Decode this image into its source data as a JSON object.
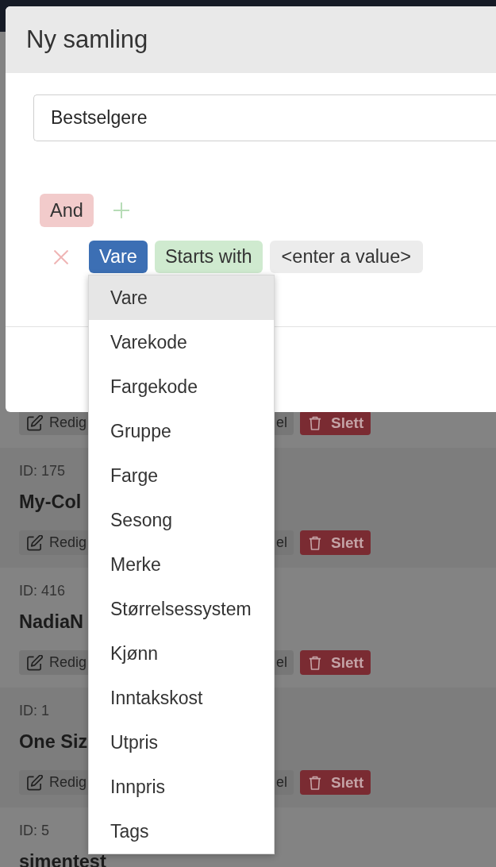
{
  "modal": {
    "title": "Ny samling",
    "name_field": {
      "value": "Bestselgere"
    },
    "filter": {
      "operator": "And",
      "conditions": [
        {
          "field": "Vare",
          "comparison": "Starts with",
          "value": "<enter a value>",
          "field_menu": [
            {
              "label": "Vare",
              "selected": true
            },
            {
              "label": "Varekode",
              "selected": false
            },
            {
              "label": "Fargekode",
              "selected": false
            },
            {
              "label": "Gruppe",
              "selected": false
            },
            {
              "label": "Farge",
              "selected": false
            },
            {
              "label": "Sesong",
              "selected": false
            },
            {
              "label": "Merke",
              "selected": false
            },
            {
              "label": "Størrelsessystem",
              "selected": false
            },
            {
              "label": "Kjønn",
              "selected": false
            },
            {
              "label": "Inntakskost",
              "selected": false
            },
            {
              "label": "Utpris",
              "selected": false
            },
            {
              "label": "Innpris",
              "selected": false
            },
            {
              "label": "Tags",
              "selected": false
            }
          ]
        }
      ]
    }
  },
  "collections": [
    {
      "actions": [
        {
          "kind": "edit",
          "label": "Redig"
        },
        {
          "kind": "secondary",
          "label": "el"
        },
        {
          "kind": "delete",
          "label": "Slett"
        }
      ]
    },
    {
      "id_text": "ID: 175",
      "name": "My-Col",
      "actions": [
        {
          "kind": "edit",
          "label": "Redig"
        },
        {
          "kind": "secondary",
          "label": "el"
        },
        {
          "kind": "delete",
          "label": "Slett"
        }
      ]
    },
    {
      "id_text": "ID: 416",
      "name": "NadiaN",
      "actions": [
        {
          "kind": "edit",
          "label": "Redig"
        },
        {
          "kind": "secondary",
          "label": "el"
        },
        {
          "kind": "delete",
          "label": "Slett"
        }
      ]
    },
    {
      "id_text": "ID: 1",
      "name": "One Siz",
      "actions": [
        {
          "kind": "edit",
          "label": "Redig"
        },
        {
          "kind": "secondary",
          "label": "el"
        },
        {
          "kind": "delete",
          "label": "Slett"
        }
      ]
    },
    {
      "id_text": "ID: 5",
      "name": "simentest"
    }
  ]
}
